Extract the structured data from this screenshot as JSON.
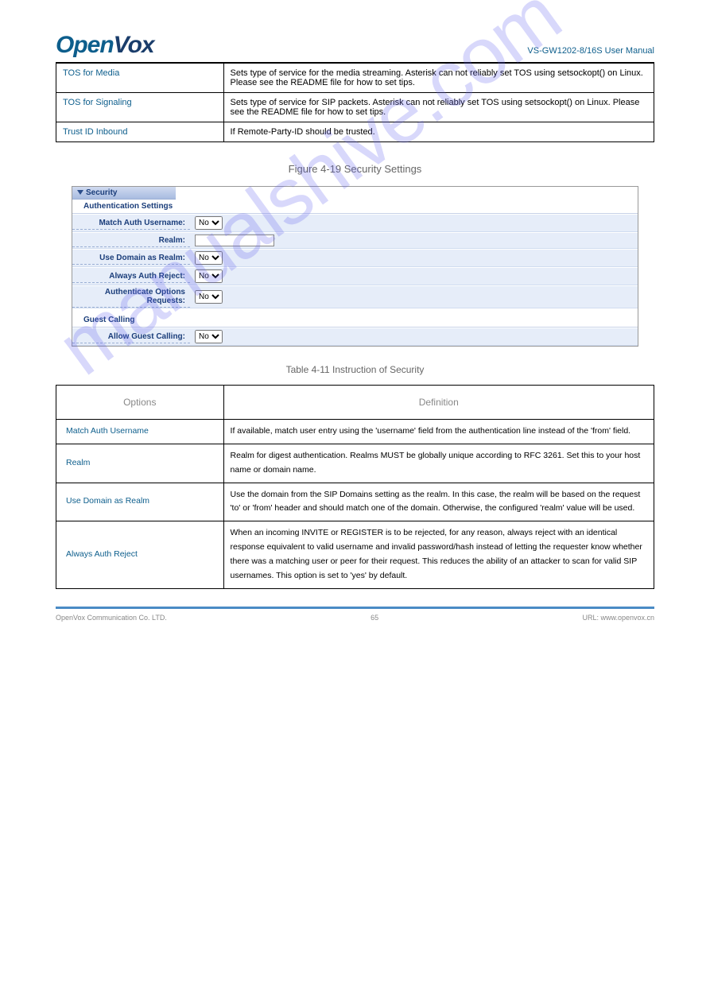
{
  "watermark": "manualshive.com",
  "header": {
    "logo_open": "Open",
    "logo_vox": "Vox",
    "product": "VS-GW1202-8/16S User Manual"
  },
  "table1": {
    "rows": [
      {
        "opt": "TOS for Media",
        "def": "Sets type of service for the media streaming. Asterisk can not reliably set TOS using setsockopt() on Linux. Please see the README file for how to set tips."
      },
      {
        "opt": "TOS for Signaling",
        "def": "Sets type of service for SIP packets. Asterisk can not reliably set TOS using setsockopt() on Linux. Please see the README file for how to set tips."
      },
      {
        "opt": "Trust ID Inbound",
        "def": "If Remote-Party-ID should be trusted."
      }
    ]
  },
  "fig": {
    "tab": "Security",
    "section1": "Authentication Settings",
    "rows1": [
      {
        "label": "Match Auth Username:",
        "type": "select",
        "value": "No"
      },
      {
        "label": "Realm:",
        "type": "text",
        "value": ""
      },
      {
        "label": "Use Domain as Realm:",
        "type": "select",
        "value": "No"
      },
      {
        "label": "Always Auth Reject:",
        "type": "select",
        "value": "No"
      },
      {
        "label": "Authenticate Options Requests:",
        "type": "select",
        "value": "No"
      }
    ],
    "section2": "Guest Calling",
    "rows2": [
      {
        "label": "Allow Guest Calling:",
        "type": "select",
        "value": "No"
      }
    ]
  },
  "caption_fig": "Figure 4-19 Security Settings",
  "caption_tbl": "Table 4-11 Instruction of Security",
  "table2": {
    "h1": "Options",
    "h2": "Definition",
    "rows": [
      {
        "opt": "Match Auth Username",
        "def": "If available, match user entry using the 'username' field from the authentication line instead of the 'from' field."
      },
      {
        "opt": "Realm",
        "def": "Realm for digest authentication. Realms MUST be globally unique according to RFC 3261. Set this to your host name or domain name."
      },
      {
        "opt": "Use Domain as Realm",
        "def": "Use the domain from the SIP Domains setting as the realm. In this case, the realm will be based on the request 'to' or 'from' header and should match one of the domain. Otherwise, the configured 'realm' value will be used."
      },
      {
        "opt": "Always Auth Reject",
        "def": "When an incoming INVITE or REGISTER is to be rejected, for any reason, always reject with an identical response equivalent to valid username and invalid password/hash instead of letting the requester know whether there was a matching user or peer for their request. This reduces the ability of an attacker to scan for valid SIP usernames. This option is set to 'yes' by default."
      }
    ]
  },
  "footer": {
    "left": "OpenVox Communication Co. LTD.",
    "right": "URL: www.openvox.cn",
    "page": "65"
  }
}
